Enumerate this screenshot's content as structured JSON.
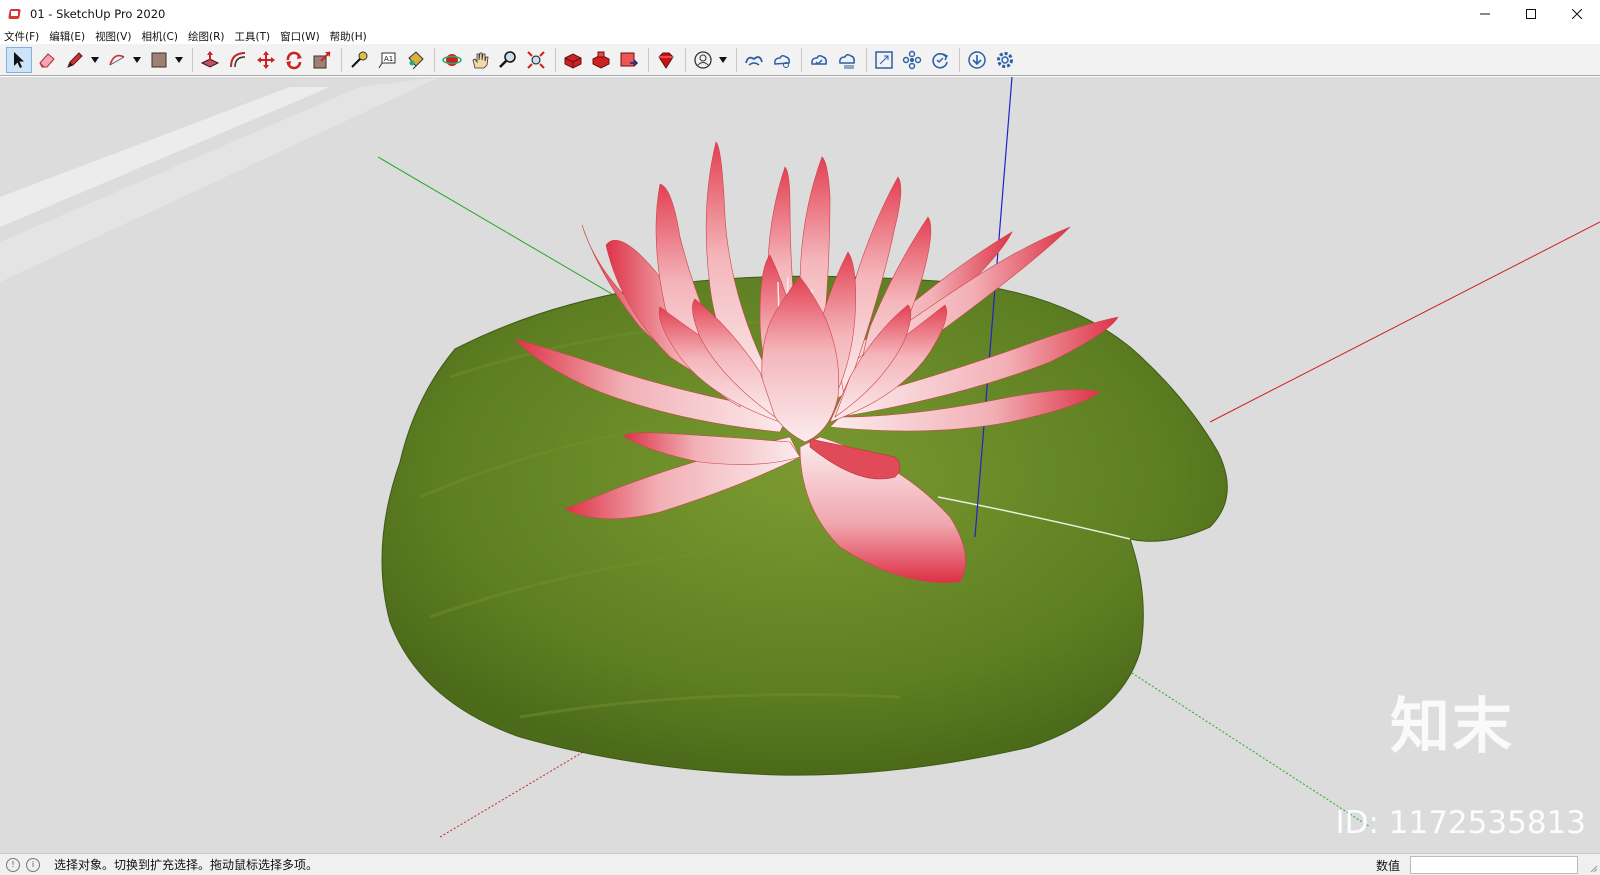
{
  "window": {
    "title": "01 - SketchUp Pro 2020",
    "controls": [
      "minimize-icon",
      "maximize-icon",
      "close-icon"
    ]
  },
  "menu": [
    {
      "label": "文件(F)"
    },
    {
      "label": "编辑(E)"
    },
    {
      "label": "视图(V)"
    },
    {
      "label": "相机(C)"
    },
    {
      "label": "绘图(R)"
    },
    {
      "label": "工具(T)"
    },
    {
      "label": "窗口(W)"
    },
    {
      "label": "帮助(H)"
    }
  ],
  "toolbar": {
    "active_tool": "select",
    "tools": [
      "select-icon",
      "eraser-icon",
      "pencil-icon",
      "arc-icon",
      "rectangle-icon",
      "push-pull-icon",
      "offset-icon",
      "move-icon",
      "rotate-icon",
      "scale-icon",
      "tape-measure-icon",
      "text-icon",
      "paint-bucket-icon",
      "orbit-icon",
      "pan-icon",
      "zoom-icon",
      "zoom-extents-icon",
      "3d-warehouse-icon",
      "extension-warehouse-icon",
      "send-to-layout-icon",
      "ruby-icon",
      "account-icon",
      "trimble-connect-icon",
      "collaborate-icon",
      "cloud-sync-icon",
      "cloud-list-icon",
      "frame-icon",
      "components-icon",
      "refresh-icon",
      "download-icon",
      "settings-icon"
    ]
  },
  "viewport": {
    "watermark_logo": "知末",
    "watermark_id": "ID: 1172535813",
    "axis_colors": {
      "red": "#cc2222",
      "green": "#22aa22",
      "blue": "#2222cc"
    }
  },
  "status": {
    "message": "选择对象。切换到扩充选择。拖动鼠标选择多项。",
    "measurement_label": "数值",
    "measurement_value": ""
  }
}
